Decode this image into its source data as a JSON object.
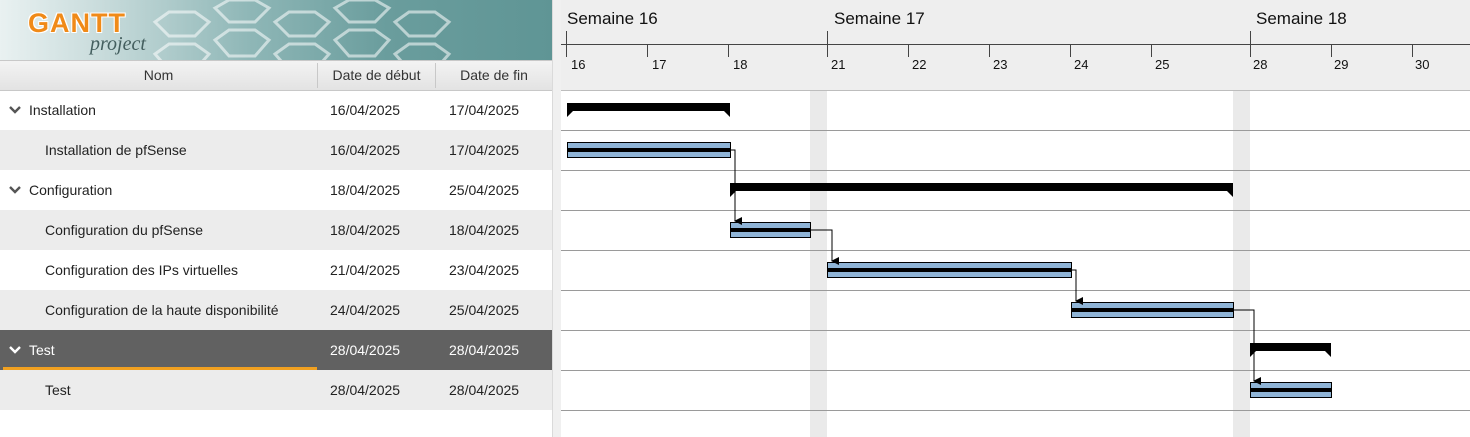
{
  "app": {
    "logo_main": "GANTT",
    "logo_sub": "project"
  },
  "table": {
    "columns": [
      "Nom",
      "Date de début",
      "Date de fin"
    ],
    "rows": [
      {
        "name": "Installation",
        "start": "16/04/2025",
        "end": "17/04/2025",
        "level": 0,
        "expanded": true
      },
      {
        "name": "Installation de pfSense",
        "start": "16/04/2025",
        "end": "17/04/2025",
        "level": 1
      },
      {
        "name": "Configuration",
        "start": "18/04/2025",
        "end": "25/04/2025",
        "level": 0,
        "expanded": true
      },
      {
        "name": "Configuration du pfSense",
        "start": "18/04/2025",
        "end": "18/04/2025",
        "level": 1
      },
      {
        "name": "Configuration des IPs virtuelles",
        "start": "21/04/2025",
        "end": "23/04/2025",
        "level": 1
      },
      {
        "name": "Configuration de la haute disponibilité",
        "start": "24/04/2025",
        "end": "25/04/2025",
        "level": 1
      },
      {
        "name": "Test",
        "start": "28/04/2025",
        "end": "28/04/2025",
        "level": 0,
        "expanded": true,
        "selected": true
      },
      {
        "name": "Test",
        "start": "28/04/2025",
        "end": "28/04/2025",
        "level": 1
      }
    ]
  },
  "timeline": {
    "weeks": [
      "Semaine 16",
      "Semaine 17",
      "Semaine 18"
    ],
    "days": [
      "16",
      "17",
      "18",
      "21",
      "22",
      "23",
      "24",
      "25",
      "28",
      "29",
      "30"
    ]
  },
  "colors": {
    "task_bar": "#8fb4d6",
    "summary_bar": "#000000",
    "selected_row": "#616161",
    "selection_accent": "#f0a020",
    "weekend_band": "#eaeaea"
  }
}
